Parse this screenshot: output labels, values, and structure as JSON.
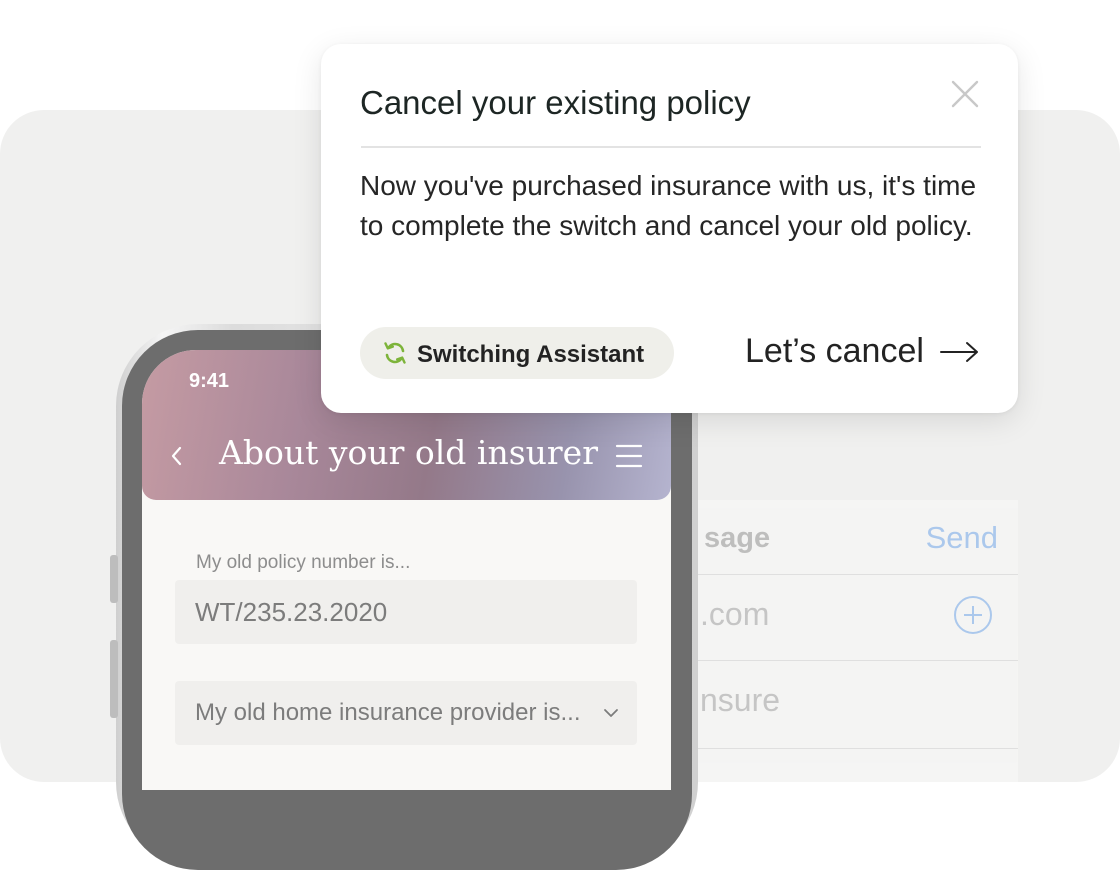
{
  "modal": {
    "title": "Cancel your existing policy",
    "body": "Now you've purchased insurance with us, it's time to complete the switch and cancel your old policy.",
    "chip_label": "Switching Assistant",
    "chip_icon": "refresh-icon",
    "cta_label": "Let’s cancel",
    "cta_icon": "arrow-right-icon",
    "close_icon": "close-icon"
  },
  "phone": {
    "status_time": "9:41",
    "header_title": "About your old insurer",
    "back_icon": "chevron-left-icon",
    "menu_icon": "hamburger-menu-icon",
    "policy_field": {
      "label": "My old policy number is...",
      "value": "WT/235.23.2020"
    },
    "provider_select": {
      "placeholder": "My old home insurance provider is...",
      "icon": "chevron-down-icon"
    }
  },
  "mail": {
    "title_fragment": "sage",
    "send_label": "Send",
    "to_fragment": ".com",
    "subject_fragment": "nsure",
    "body_fragment": "...",
    "add_icon": "plus-circle-icon"
  },
  "colors": {
    "accent_green": "#7db43a",
    "send_blue": "#8fb8ec",
    "chip_bg": "#efefea",
    "header_gradient_start": "#c59ba3",
    "header_gradient_end": "#b5b4cf"
  }
}
